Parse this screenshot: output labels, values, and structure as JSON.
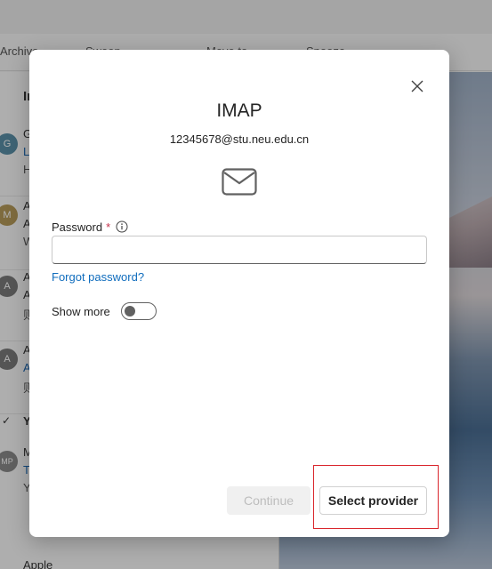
{
  "background": {
    "toolbar": [
      "Archive",
      "Sweep",
      "Move to",
      "Snooze"
    ],
    "section_title": "Inbox",
    "items": [
      {
        "avatar": "G",
        "avatar_color": "#5a8fa6",
        "l1": "G",
        "l2": "L",
        "l3": "H"
      },
      {
        "avatar": "M",
        "avatar_color": "#b59a5a",
        "l1": "A",
        "l2": "A",
        "l3": "W"
      },
      {
        "avatar": "A",
        "avatar_color": "#7a7a7a",
        "l1": "A",
        "l2": "A",
        "l3": "则"
      },
      {
        "avatar": "A",
        "avatar_color": "#7a7a7a",
        "l1": "A",
        "l2": "A",
        "l3": "则"
      }
    ],
    "group_label": "Y",
    "group_item": {
      "avatar": "MP",
      "avatar_color": "#8a8a8a",
      "l1": "M",
      "l2": "T",
      "l3": "Y"
    },
    "bottom_item": "Apple"
  },
  "dialog": {
    "title": "IMAP",
    "email": "12345678@stu.neu.edu.cn",
    "password_label": "Password",
    "required_mark": "*",
    "password_value": "",
    "forgot_link": "Forgot password?",
    "show_more_label": "Show more",
    "show_more_on": false,
    "continue_label": "Continue",
    "select_provider_label": "Select provider",
    "icons": [
      "close-icon",
      "mail-icon",
      "info-icon"
    ]
  },
  "colors": {
    "link": "#0f6cbd",
    "required": "#c4314b",
    "highlight": "#d9252c"
  }
}
